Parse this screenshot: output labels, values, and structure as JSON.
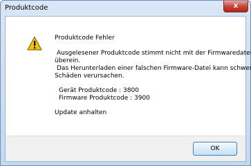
{
  "window": {
    "title": "Produktcode",
    "close_label": "x"
  },
  "message": {
    "heading": "Produktcode Fehler",
    "line1": "Ausgelesener Produktcode stimmt nicht mit der Firmwaredatei",
    "line2": "überein.",
    "line3": "Das Herunterladen einer falschen Firmware-Datei kann schwere",
    "line4": "Schäden verursachen.",
    "device_code": "Gerät Produktcode : 3800",
    "firmware_code": "Firmware Produktcode : 3900",
    "action": "Update anhalten"
  },
  "buttons": {
    "ok_label": "OK"
  },
  "icons": {
    "dialog_icon": "warning-icon",
    "close": "close-icon"
  },
  "colors": {
    "close_button": "#c7473a",
    "warning_fill": "#f5c400",
    "ok_border": "#3c7fb1"
  }
}
